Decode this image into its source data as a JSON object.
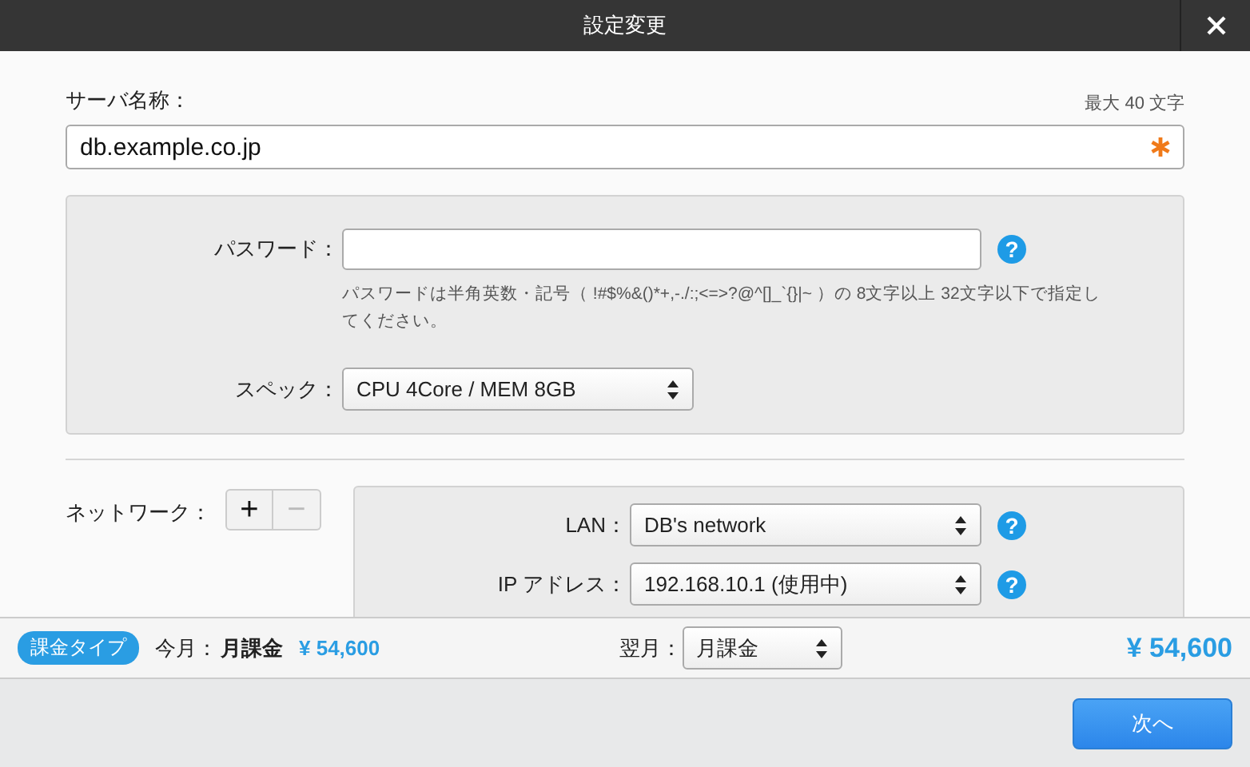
{
  "window": {
    "title": "設定変更"
  },
  "server_name": {
    "label": "サーバ名称：",
    "limit": "最大 40 文字",
    "value": "db.example.co.jp",
    "required": true
  },
  "password": {
    "label": "パスワード：",
    "help": "?",
    "hint": "パスワードは半角英数・記号（ !#$%&()*+,-./:;<=>?@^[]_`{}|~ ）の 8文字以上 32文字以下で指定してください。"
  },
  "spec": {
    "label": "スペック：",
    "value": "CPU 4Core / MEM 8GB"
  },
  "network": {
    "label": "ネットワーク：",
    "add": {
      "text": "+",
      "disabled": false
    },
    "remove": {
      "text": "−",
      "disabled": true
    },
    "fields": [
      {
        "label": "LAN：",
        "value": "DB's network",
        "help": "?"
      },
      {
        "label": "IP アドレス：",
        "value": "192.168.10.1 (使用中)",
        "help": "?"
      }
    ]
  },
  "billing": {
    "badge": "課金タイプ",
    "current_label": "今月：",
    "current_plan": "月課金",
    "current_price": "¥ 54,600",
    "next_label": "翌月：",
    "next_plan": "月課金",
    "total": "¥ 54,600"
  },
  "next_button": "次へ"
}
